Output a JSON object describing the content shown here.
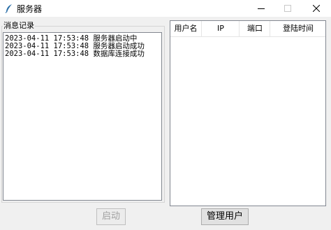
{
  "window": {
    "title": "服务器",
    "icon": "feather-icon",
    "controls": [
      "minimize-icon",
      "maximize-icon",
      "close-icon"
    ]
  },
  "log": {
    "legend": "消息记录",
    "lines": [
      "2023-04-11 17:53:48 服务器启动中",
      "2023-04-11 17:53:48 服务器启动成功",
      "2023-04-11 17:53:48 数据库连接成功"
    ]
  },
  "users_table": {
    "columns": [
      "用户名",
      "IP",
      "端口",
      "登陆时间"
    ],
    "rows": []
  },
  "buttons": {
    "start": "启动",
    "manage_users": "管理用户"
  },
  "colors": {
    "window_bg": "#f0f0f0",
    "disabled_text": "#a0a0a0"
  }
}
